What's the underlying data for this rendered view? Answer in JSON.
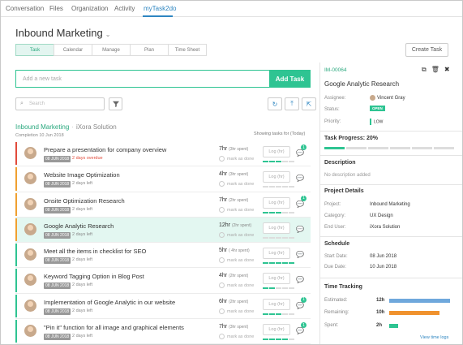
{
  "nav": {
    "tabs": [
      "Conversation",
      "Files",
      "Organization",
      "Activity",
      "myTask2do"
    ]
  },
  "page": {
    "title": "Inbound Marketing",
    "subtabs": [
      "Task",
      "Calendar",
      "Manage",
      "Plan",
      "Time Sheet"
    ],
    "create_label": "Create Task"
  },
  "add_task": {
    "placeholder": "Add a new task",
    "button": "Add Task"
  },
  "search": {
    "placeholder": "Search"
  },
  "project": {
    "name": "Inbound Marketing",
    "client": "iXora Solution",
    "completion": "Completion 10 Jun 2018",
    "showing": "Showing tasks for (Today)"
  },
  "tasks": [
    {
      "title": "Prepare a presentation for company overview",
      "date": "08 JUN 2018",
      "due": "2 days overdue",
      "overdue": true,
      "hours": "7hr",
      "spent": "(3hr spent)",
      "mark": "mark as done",
      "log": "Log (hr)",
      "color": "#e24b3b",
      "badge": "1"
    },
    {
      "title": "Website Image Optimization",
      "date": "08 JUN 2018",
      "due": "2 days left",
      "overdue": false,
      "hours": "4hr",
      "spent": "(3hr spent)",
      "mark": "mark as done",
      "log": "Log (hr)",
      "color": "#f0a030",
      "badge": ""
    },
    {
      "title": "Onsite Optimization Research",
      "date": "08 JUN 2018",
      "due": "2 days left",
      "overdue": false,
      "hours": "7hr",
      "spent": "(2hr spent)",
      "mark": "mark as done",
      "log": "Log (hr)",
      "color": "#f0a030",
      "badge": "1"
    },
    {
      "title": "Google Analytic Research",
      "date": "08 JUN 2018",
      "due": "2 days left",
      "overdue": false,
      "hours": "12hr",
      "spent": "(2hr spent)",
      "mark": "mark as done",
      "log": "Log (hr)",
      "color": "#f0a030",
      "badge": ""
    },
    {
      "title": "Meet all the items in checklist for SEO",
      "date": "08 JUN 2018",
      "due": "2 days left",
      "overdue": false,
      "hours": "5hr",
      "spent": "( 4hr spent)",
      "mark": "mark as done",
      "log": "Log (hr)",
      "color": "#2ec492",
      "badge": ""
    },
    {
      "title": "Keyword Tagging Option in Blog Post",
      "date": "08 JUN 2018",
      "due": "2 days left",
      "overdue": false,
      "hours": "4hr",
      "spent": "(2hr spent)",
      "mark": "mark as done",
      "log": "Log (hr)",
      "color": "#2ec492",
      "badge": ""
    },
    {
      "title": "Implementation of Google Analytic in our website",
      "date": "08 JUN 2018",
      "due": "2 days left",
      "overdue": false,
      "hours": "6hr",
      "spent": "(2hr spent)",
      "mark": "mark as done",
      "log": "Log (hr)",
      "color": "#2ec492",
      "badge": "1"
    },
    {
      "title": "\"Pin it\" function for all image and graphical elements",
      "date": "08 JUN 2018",
      "due": "2 days left",
      "overdue": false,
      "hours": "7hr",
      "spent": "(3hr spent)",
      "mark": "mark as done",
      "log": "Log (hr)",
      "color": "#2ec492",
      "badge": "1"
    }
  ],
  "detail": {
    "id": "IM-00064",
    "title": "Google Analytic Research",
    "assignee_label": "Assignee:",
    "assignee": "Vincent Gray",
    "status_label": "Status:",
    "status": "OPEN",
    "priority_label": "Priority:",
    "priority": "LOW",
    "progress_label": "Task Progress: 20%",
    "progress": 0.2,
    "description_heading": "Description",
    "description": "No description added",
    "project_heading": "Project Details",
    "project_label": "Project:",
    "project": "Inbound Marketing",
    "category_label": "Category:",
    "category": "UX Design",
    "enduser_label": "End User:",
    "enduser": "iXora Solution",
    "schedule_heading": "Schedule",
    "start_label": "Start Date:",
    "start": "08 Jun 2018",
    "due_label": "Due Date:",
    "due": "10 Jun 2018",
    "time_heading": "Time Tracking",
    "estimated_label": "Estimated:",
    "estimated": "12h",
    "remaining_label": "Remaining:",
    "remaining": "10h",
    "spent_label": "Spent:",
    "spent": "2h",
    "view_logs": "View time logs"
  },
  "colors": {
    "accent": "#2ec492",
    "link": "#2e86c1",
    "estimated_bar": "#6fa8dc",
    "remaining_bar": "#f0922e",
    "spent_bar": "#2ec492"
  }
}
